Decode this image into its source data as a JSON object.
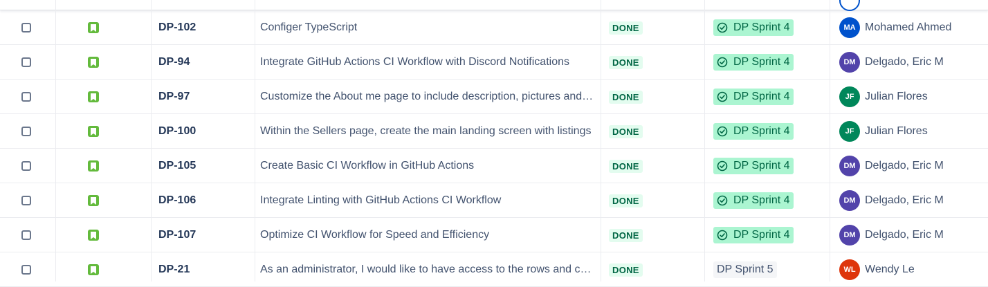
{
  "colors": {
    "done_bg": "#e3fcef",
    "done_text": "#006644",
    "sprint_done_bg": "#abf5d1",
    "story_icon": "#63ba3c"
  },
  "rows": [
    {
      "key": "DP-102",
      "summary": "Configer TypeScript",
      "status": "DONE",
      "sprint": "DP Sprint 4",
      "sprint_done": true,
      "initials": "MA",
      "assignee": "Mohamed Ahmed",
      "avatar_color": "#0052cc"
    },
    {
      "key": "DP-94",
      "summary": "Integrate GitHub Actions CI Workflow with Discord Notifications",
      "status": "DONE",
      "sprint": "DP Sprint 4",
      "sprint_done": true,
      "initials": "DM",
      "assignee": "Delgado, Eric M",
      "avatar_color": "#5243aa"
    },
    {
      "key": "DP-97",
      "summary": "Customize the About me page to include description, pictures and links",
      "status": "DONE",
      "sprint": "DP Sprint 4",
      "sprint_done": true,
      "initials": "JF",
      "assignee": "Julian Flores",
      "avatar_color": "#00875a"
    },
    {
      "key": "DP-100",
      "summary": "Within the Sellers page, create the main landing screen with listings",
      "status": "DONE",
      "sprint": "DP Sprint 4",
      "sprint_done": true,
      "initials": "JF",
      "assignee": "Julian Flores",
      "avatar_color": "#00875a"
    },
    {
      "key": "DP-105",
      "summary": "Create Basic CI Workflow in GitHub Actions",
      "status": "DONE",
      "sprint": "DP Sprint 4",
      "sprint_done": true,
      "initials": "DM",
      "assignee": "Delgado, Eric M",
      "avatar_color": "#5243aa"
    },
    {
      "key": "DP-106",
      "summary": "Integrate Linting with GitHub Actions CI Workflow",
      "status": "DONE",
      "sprint": "DP Sprint 4",
      "sprint_done": true,
      "initials": "DM",
      "assignee": "Delgado, Eric M",
      "avatar_color": "#5243aa"
    },
    {
      "key": "DP-107",
      "summary": "Optimize CI Workflow for Speed and Efficiency",
      "status": "DONE",
      "sprint": "DP Sprint 4",
      "sprint_done": true,
      "initials": "DM",
      "assignee": "Delgado, Eric M",
      "avatar_color": "#5243aa"
    },
    {
      "key": "DP-21",
      "summary": "As an administrator, I would like to have access to the rows and columns",
      "status": "DONE",
      "sprint": "DP Sprint 5",
      "sprint_done": false,
      "initials": "WL",
      "assignee": "Wendy Le",
      "avatar_color": "#de350b"
    }
  ]
}
